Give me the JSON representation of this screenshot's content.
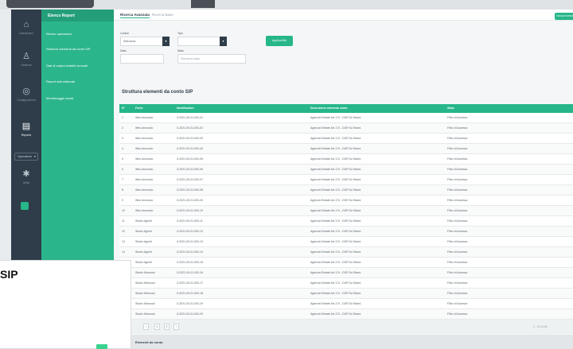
{
  "colors": {
    "accent": "#26b68a",
    "nav": "#2f3d4a",
    "submenu": "#2bb58a"
  },
  "nav": {
    "items": [
      {
        "icon": "home-icon",
        "label": "Dashboard"
      },
      {
        "icon": "user-icon",
        "label": "Gestione"
      },
      {
        "icon": "settings-icon",
        "label": "Configurazione"
      },
      {
        "icon": "document-icon",
        "label": "Reports"
      },
      {
        "icon": "gear-icon",
        "label": "Utility"
      }
    ],
    "select_label": "Operatore"
  },
  "submenu": {
    "title": "Elenco Report",
    "items": [
      "Elenco operazioni",
      "Struttura elementi da conto SIP",
      "Dati di output sintetici annuali",
      "Report dati elaborati",
      "Monitoraggio avvisi"
    ]
  },
  "tabs": [
    "Ricerca Avanzata",
    "Ricerca Base"
  ],
  "top_button": "Nuova ricerca",
  "filters": {
    "codice_label": "Codice",
    "codice_value": "Seleziona",
    "tipo_label": "Tipo",
    "tipo_value": "",
    "data_label": "Data",
    "stato_label": "Stato",
    "stato_placeholder": "Seleziona stato",
    "search_button": "Applica filtri"
  },
  "section_title": "Struttura elementi da conto SIP",
  "table": {
    "columns": [
      "N°",
      "Fonte",
      "Identificativo",
      "Descrizione elemento conto",
      "Stato"
    ],
    "rows": [
      [
        "1",
        "Wes Annunzio",
        "0-2021-00-01-000-01",
        "Agenzia Entrate Art.174 - DGR Sz.Stand.",
        "Filtro di Accesso"
      ],
      [
        "2",
        "Wes Annunzio",
        "0-2021-00-01-000-02",
        "Agenzia Entrate Art.174 - DGR Sz.Stand.",
        "Filtro di Accesso"
      ],
      [
        "3",
        "Wes Annunzio",
        "0-2021-00-01-000-03",
        "Agenzia Entrate Art.174 - DGR Sz.Stand.",
        "Filtro di Accesso"
      ],
      [
        "4",
        "Wes Annunzio",
        "0-2021-00-01-000-04",
        "Agenzia Entrate Art.174 - DGR Sz.Stand.",
        "Filtro di Accesso"
      ],
      [
        "5",
        "Wes Annunzio",
        "0-2021-00-01-000-05",
        "Agenzia Entrate Art.174 - DGR Sz.Stand.",
        "Filtro di Accesso"
      ],
      [
        "6",
        "Wes Annunzio",
        "0-2021-00-01-000-06",
        "Agenzia Entrate Art.174 - DGR Sz.Stand.",
        "Filtro di Accesso"
      ],
      [
        "7",
        "Wes Annunzio",
        "0-2021-00-01-000-07",
        "Agenzia Entrate Art.174 - DGR Sz.Stand.",
        "Filtro di Accesso"
      ],
      [
        "8",
        "Wes Annunzio",
        "0-2021-00-01-000-08",
        "Agenzia Entrate Art.174 - DGR Sz.Stand.",
        "Filtro di Accesso"
      ],
      [
        "9",
        "Wes Annunzio",
        "0-2021-00-01-000-09",
        "Agenzia Entrate Art.174 - DGR Sz.Stand.",
        "Filtro di Accesso"
      ],
      [
        "10",
        "Wes Annunzio",
        "0-2021-00-01-000-10",
        "Agenzia Entrate Art.174 - DGR Sz.Stand.",
        "Filtro di Accesso"
      ],
      [
        "11",
        "Studio Agenti",
        "0-2021-00-01-000-11",
        "Agenzia Entrate Art.174 - DGR Sz.Stand.",
        "Filtro di Accesso"
      ],
      [
        "12",
        "Studio Agenti",
        "0-2021-00-01-000-12",
        "Agenzia Entrate Art.174 - DGR Sz.Stand.",
        "Filtro di Accesso"
      ],
      [
        "13",
        "Studio Agenti",
        "0-2021-00-01-000-13",
        "Agenzia Entrate Art.174 - DGR Sz.Stand.",
        "Filtro di Accesso"
      ],
      [
        "14",
        "Studio Agenti",
        "0-2021-00-01-000-14",
        "Agenzia Entrate Art.174 - DGR Sz.Stand.",
        "Filtro di Accesso"
      ],
      [
        "15",
        "Studio Agenti",
        "0-2021-00-01-000-15",
        "Agenzia Entrate Art.174 - DGR Sz.Stand.",
        "Filtro di Accesso"
      ],
      [
        "16",
        "Studio Marcucci",
        "0-2021-00-01-000-16",
        "Agenzia Entrate Art.174 - DGR Sz.Stand.",
        "Filtro di Accesso"
      ],
      [
        "17",
        "Studio Marcucci",
        "0-2021-00-01-000-17",
        "Agenzia Entrate Art.174 - DGR Sz.Stand.",
        "Filtro di Accesso"
      ],
      [
        "18",
        "Studio Marcucci",
        "0-2021-00-01-000-18",
        "Agenzia Entrate Art.174 - DGR Sz.Stand.",
        "Filtro di Accesso"
      ],
      [
        "19",
        "Studio Marcucci",
        "0-2021-00-01-000-19",
        "Agenzia Entrate Art.174 - DGR Sz.Stand.",
        "Filtro di Accesso"
      ],
      [
        "20",
        "Studio Marcucci",
        "0-2021-00-01-000-20",
        "Agenzia Entrate Art.174 - DGR Sz.Stand.",
        "Filtro di Accesso"
      ]
    ]
  },
  "pager": {
    "pages": [
      "1",
      "2",
      "3"
    ],
    "summary": "1 - 20 di 45"
  },
  "lower_section": "Elementi da conto",
  "overlay": {
    "title": "SIP"
  }
}
